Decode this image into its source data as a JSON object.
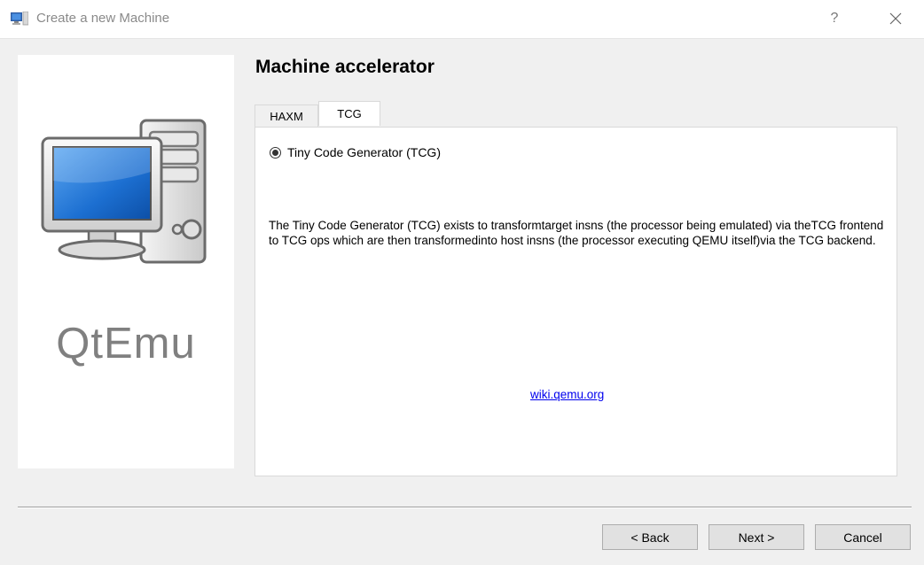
{
  "window": {
    "title": "Create a new Machine",
    "help_label": "?"
  },
  "side": {
    "brand": "QtEmu"
  },
  "page": {
    "title": "Machine accelerator",
    "tabs": [
      {
        "label": "HAXM",
        "active": false
      },
      {
        "label": "TCG",
        "active": true
      }
    ]
  },
  "tcg": {
    "radio_label": "Tiny Code Generator (TCG)",
    "radio_checked": true,
    "description": "The Tiny Code Generator (TCG) exists to transformtarget insns (the processor being emulated) via theTCG frontend to TCG ops which are then transformedinto host insns (the processor executing QEMU itself)via the TCG backend.",
    "link_text": "wiki.qemu.org"
  },
  "buttons": {
    "back": "< Back",
    "next": "Next >",
    "cancel": "Cancel"
  },
  "icons": {
    "app": "qtemu-app-icon",
    "computer": "computer-icon",
    "close": "close-icon"
  }
}
